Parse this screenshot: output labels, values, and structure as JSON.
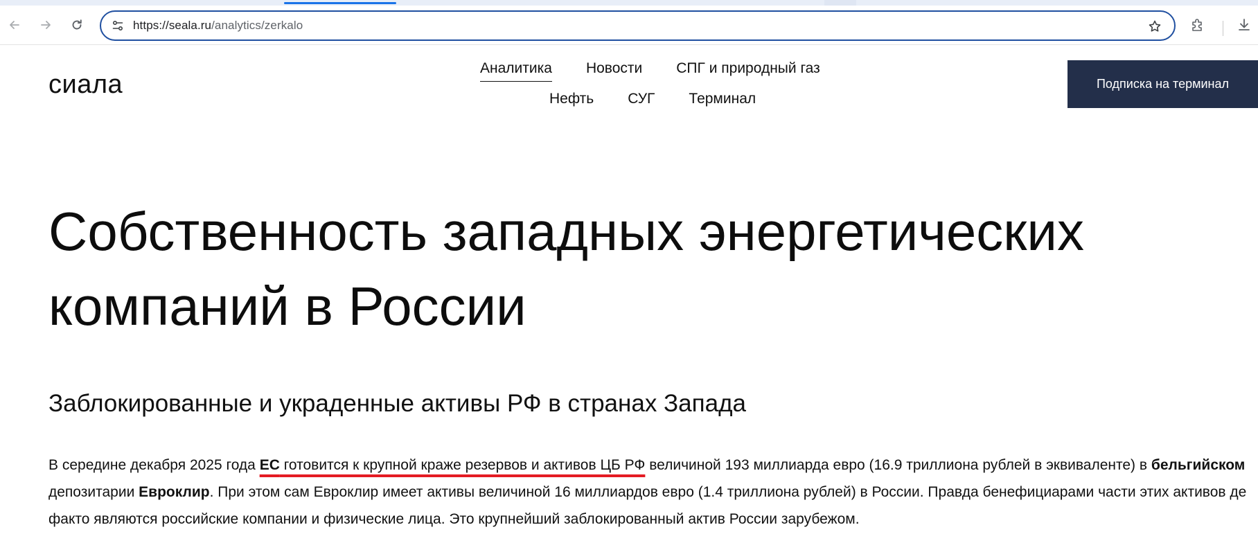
{
  "browser": {
    "url_host": "https://seala.ru",
    "url_path": "/analytics/zerkalo",
    "icons": {
      "back": "arrow-left-icon",
      "forward": "arrow-right-icon",
      "reload": "reload-icon",
      "site_info": "tune-icon",
      "bookmark": "star-icon",
      "extensions": "puzzle-icon",
      "downloads": "download-icon"
    },
    "accent": "#1a73e8"
  },
  "site": {
    "logo": "сиала",
    "nav_row1": [
      "Аналитика",
      "Новости",
      "СПГ и природный газ"
    ],
    "nav_row2": [
      "Нефть",
      "СУГ",
      "Терминал"
    ],
    "subscribe_label": "Подписка на терминал",
    "subscribe_color": "#232f4a"
  },
  "article": {
    "title": "Собственность западных энергетических компаний в России",
    "section_title": "Заблокированные и украденные активы РФ в странах Запада",
    "para": {
      "s1": "В середине декабря 2025 года ",
      "eu": "ЕС",
      "link": " готовится к крупной краже резервов и активов ЦБ РФ",
      "s2": " величиной 193 миллиарда евро (16.9 триллиона рублей в эквиваленте) в ",
      "belgian": "бельгийском",
      "s3": " депозитарии ",
      "euroclear": "Евроклир",
      "s4": ". При этом сам Евроклир имеет активы величиной 16 миллиардов евро (1.4 триллиона рублей) в России. Правда бенефициарами части этих активов де факто являются российские компании и физические лица. Это крупнейший заблокированный актив России зарубежом."
    },
    "highlight_color": "#e41b23"
  }
}
